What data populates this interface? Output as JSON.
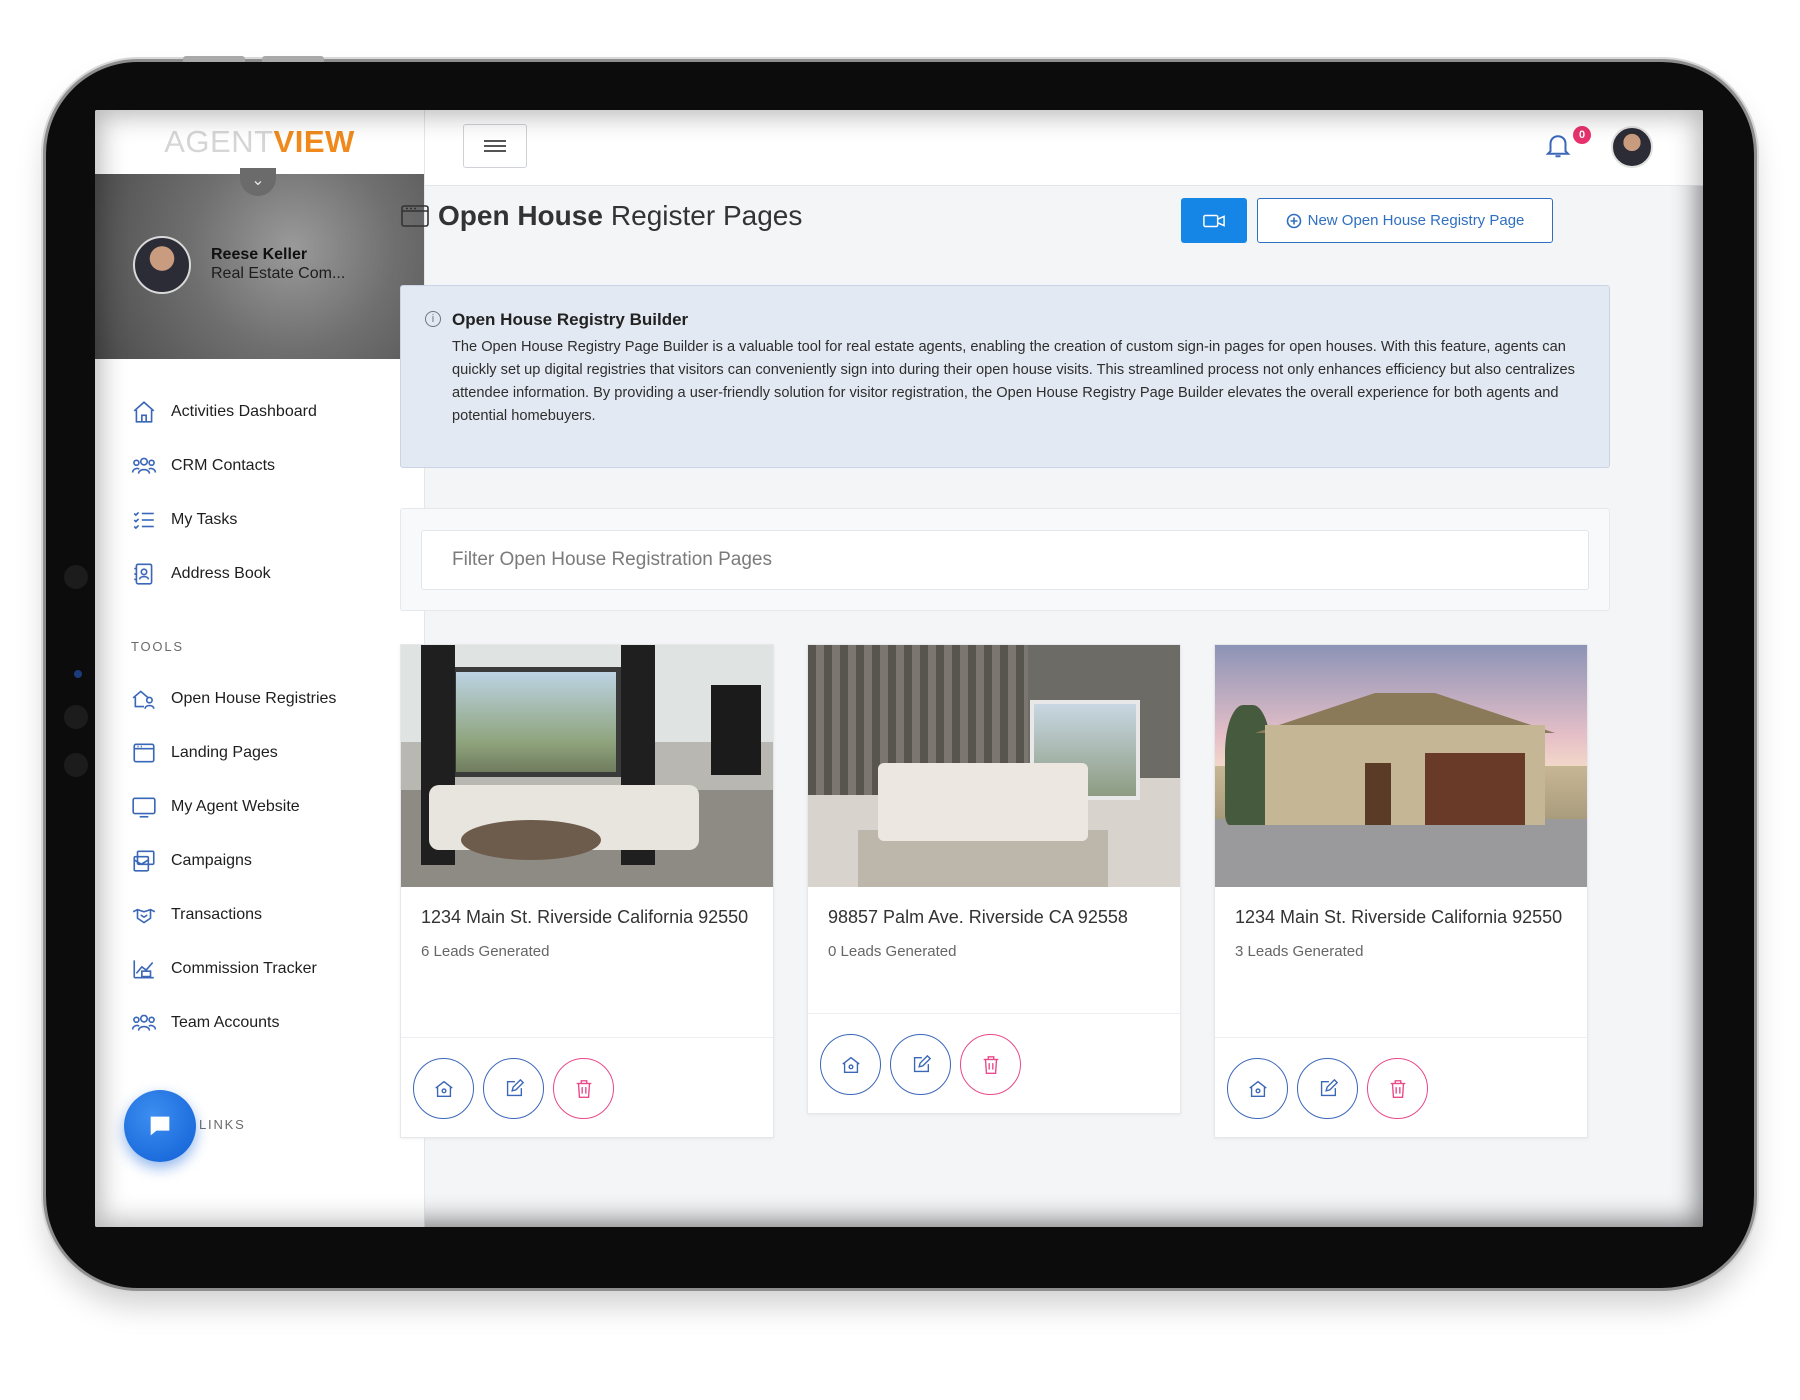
{
  "app": {
    "logo_part1": "AGENT",
    "logo_part2": "VIEW"
  },
  "profile": {
    "name": "Reese Keller",
    "role": "Real Estate Com..."
  },
  "sidebar": {
    "main_items": [
      {
        "label": "Activities Dashboard",
        "icon": "home-icon"
      },
      {
        "label": "CRM Contacts",
        "icon": "contacts-icon"
      },
      {
        "label": "My Tasks",
        "icon": "tasks-icon"
      },
      {
        "label": "Address Book",
        "icon": "address-book-icon"
      }
    ],
    "tools_label": "TOOLS",
    "tool_items": [
      {
        "label": "Open House Registries",
        "icon": "open-house-icon"
      },
      {
        "label": "Landing Pages",
        "icon": "browser-icon"
      },
      {
        "label": "My Agent Website",
        "icon": "monitor-icon"
      },
      {
        "label": "Campaigns",
        "icon": "campaigns-icon"
      },
      {
        "label": "Transactions",
        "icon": "handshake-icon"
      },
      {
        "label": "Commission Tracker",
        "icon": "chart-icon"
      },
      {
        "label": "Team Accounts",
        "icon": "team-icon"
      }
    ],
    "links_label": "LINKS"
  },
  "topbar": {
    "notification_count": "0"
  },
  "page": {
    "title_bold": "Open House",
    "title_rest": "Register Pages",
    "new_button_label": "New Open House Registry Page"
  },
  "info": {
    "title": "Open House Registry Builder",
    "text": "The Open House Registry Page Builder is a valuable tool for real estate agents, enabling the creation of custom sign-in pages for open houses. With this feature, agents can quickly set up digital registries that visitors can conveniently sign into during their open house visits. This streamlined process not only enhances efficiency but also centralizes attendee information. By providing a user-friendly solution for visitor registration, the Open House Registry Page Builder elevates the overall experience for both agents and potential homebuyers."
  },
  "filter": {
    "placeholder": "Filter Open House Registration Pages",
    "value": ""
  },
  "cards": [
    {
      "address": "1234 Main St. Riverside California 92550",
      "leads": "6 Leads Generated",
      "photo": "living-room"
    },
    {
      "address": "98857 Palm Ave. Riverside CA 92558",
      "leads": "0 Leads Generated",
      "photo": "bedroom"
    },
    {
      "address": "1234 Main St. Riverside California 92550",
      "leads": "3 Leads Generated",
      "photo": "house-exterior"
    }
  ],
  "colors": {
    "accent": "#1686e6",
    "nav_icon": "#3b67b8",
    "delete": "#e8498a",
    "logo_view": "#f08a1c",
    "badge": "#e8326e"
  }
}
